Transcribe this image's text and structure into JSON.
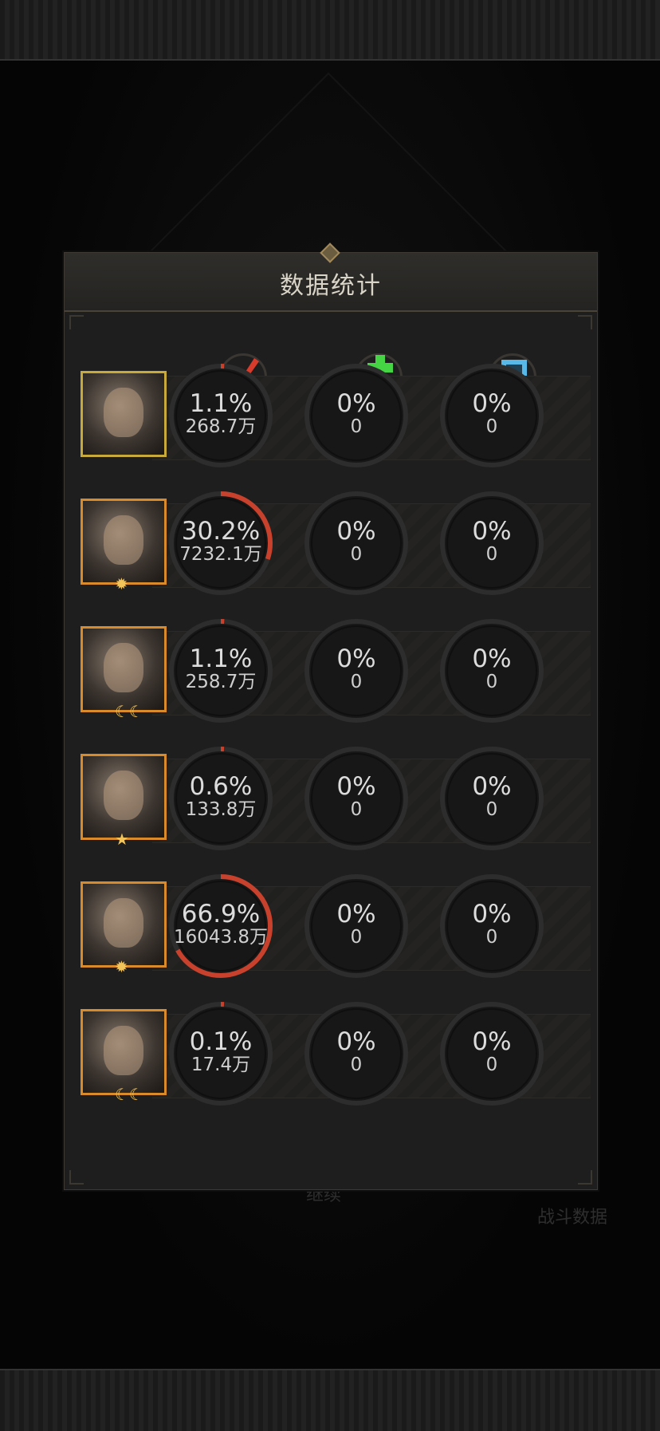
{
  "panel": {
    "title": "数据统计"
  },
  "background": {
    "battle_data_label": "战斗数据",
    "bottom_label": "继续"
  },
  "columns": [
    {
      "name": "damage",
      "icon": "sword-icon",
      "color": "#d63b2b"
    },
    {
      "name": "healing",
      "icon": "heal-cross-icon",
      "color": "#45d443"
    },
    {
      "name": "shield",
      "icon": "shield-icon",
      "color": "#58b9e8"
    }
  ],
  "colors": {
    "progress": "#c7412c",
    "ring": "#2d2d2d"
  },
  "heroes": [
    {
      "name": "hero-1",
      "frame": "gold",
      "badge": "",
      "stats": [
        {
          "pct": "1.1%",
          "value": "268.7万",
          "fraction": 0.011
        },
        {
          "pct": "0%",
          "value": "0",
          "fraction": 0
        },
        {
          "pct": "0%",
          "value": "0",
          "fraction": 0
        }
      ]
    },
    {
      "name": "hero-2",
      "frame": "orange",
      "badge": "sun",
      "stats": [
        {
          "pct": "30.2%",
          "value": "7232.1万",
          "fraction": 0.302
        },
        {
          "pct": "0%",
          "value": "0",
          "fraction": 0
        },
        {
          "pct": "0%",
          "value": "0",
          "fraction": 0
        }
      ]
    },
    {
      "name": "hero-3",
      "frame": "orange",
      "badge": "moon",
      "stats": [
        {
          "pct": "1.1%",
          "value": "258.7万",
          "fraction": 0.011
        },
        {
          "pct": "0%",
          "value": "0",
          "fraction": 0
        },
        {
          "pct": "0%",
          "value": "0",
          "fraction": 0
        }
      ]
    },
    {
      "name": "hero-4",
      "frame": "orange",
      "badge": "star",
      "stats": [
        {
          "pct": "0.6%",
          "value": "133.8万",
          "fraction": 0.006
        },
        {
          "pct": "0%",
          "value": "0",
          "fraction": 0
        },
        {
          "pct": "0%",
          "value": "0",
          "fraction": 0
        }
      ]
    },
    {
      "name": "hero-5",
      "frame": "orange",
      "badge": "sun",
      "stats": [
        {
          "pct": "66.9%",
          "value": "16043.8万",
          "fraction": 0.669
        },
        {
          "pct": "0%",
          "value": "0",
          "fraction": 0
        },
        {
          "pct": "0%",
          "value": "0",
          "fraction": 0
        }
      ]
    },
    {
      "name": "hero-6",
      "frame": "orange",
      "badge": "moon",
      "stats": [
        {
          "pct": "0.1%",
          "value": "17.4万",
          "fraction": 0.001
        },
        {
          "pct": "0%",
          "value": "0",
          "fraction": 0
        },
        {
          "pct": "0%",
          "value": "0",
          "fraction": 0
        }
      ]
    }
  ]
}
